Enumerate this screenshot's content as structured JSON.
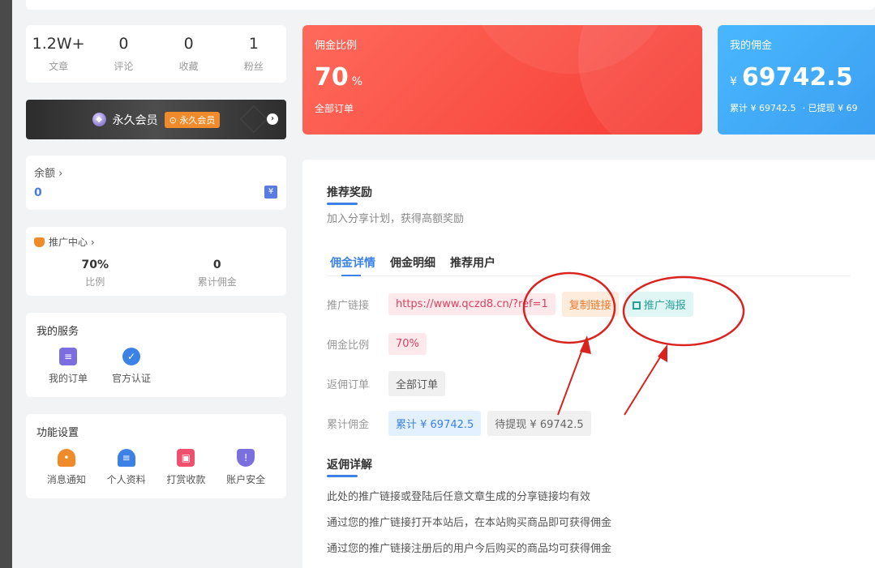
{
  "stats": [
    {
      "value": "1.2W+",
      "label": "文章"
    },
    {
      "value": "0",
      "label": "评论"
    },
    {
      "value": "0",
      "label": "收藏"
    },
    {
      "value": "1",
      "label": "粉丝"
    }
  ],
  "vip": {
    "text": "永久会员",
    "badge": "⊙ 永久会员"
  },
  "balance": {
    "title": "余额 ›",
    "value": "0",
    "icon": "¥"
  },
  "promo_center": {
    "title": "推广中心 ›",
    "items": [
      {
        "value": "70%",
        "label": "比例"
      },
      {
        "value": "0",
        "label": "累计佣金"
      }
    ]
  },
  "services": {
    "title": "我的服务",
    "items": [
      {
        "label": "我的订单",
        "icon": "clipboard-icon",
        "color": "#7b6fe0"
      },
      {
        "label": "官方认证",
        "icon": "verified-badge-icon",
        "color": "#3c82e6"
      }
    ]
  },
  "settings": {
    "title": "功能设置",
    "items": [
      {
        "label": "消息通知",
        "icon": "bell-icon",
        "color": "#f08b2c"
      },
      {
        "label": "个人资料",
        "icon": "user-profile-icon",
        "color": "#3c82e6"
      },
      {
        "label": "打赏收款",
        "icon": "gift-icon",
        "color": "#f0506e"
      },
      {
        "label": "账户安全",
        "icon": "shield-icon",
        "color": "#7b6fe0"
      }
    ]
  },
  "rate_card": {
    "title": "佣金比例",
    "value": "70",
    "unit": "%",
    "sub": "全部订单"
  },
  "my_card": {
    "title": "我的佣金",
    "currency": "¥",
    "value": "69742.5",
    "total": "累计 ¥ 69742.5",
    "withdrawn": "· 已提现 ¥ 69"
  },
  "main": {
    "title": "推荐奖励",
    "subtitle": "加入分享计划，获得高额奖励",
    "tabs": [
      "佣金详情",
      "佣金明细",
      "推荐用户"
    ],
    "rows": {
      "link_label": "推广链接",
      "link_value": "https://www.qczd8.cn/?ref=1",
      "copy_btn": "复制链接",
      "poster_btn": "推广海报",
      "rate_label": "佣金比例",
      "rate_value": "70%",
      "orders_label": "返佣订单",
      "orders_value": "全部订单",
      "total_label": "累计佣金",
      "total_value": "累计 ¥ 69742.5",
      "pending_value": "待提现 ¥ 69742.5"
    },
    "rebate_title": "返佣详解",
    "rebate_lines": [
      "此处的推广链接或登陆后任意文章生成的分享链接均有效",
      "通过您的推广链接打开本站后，在本站购买商品即可获得佣金",
      "通过您的推广链接注册后的用户今后购买的商品均可获得佣金"
    ]
  },
  "colors": {
    "accent": "#3c82e6",
    "red_card": "#f53b34",
    "blue_card": "#3c9ff1",
    "annotation": "#d9231f"
  }
}
